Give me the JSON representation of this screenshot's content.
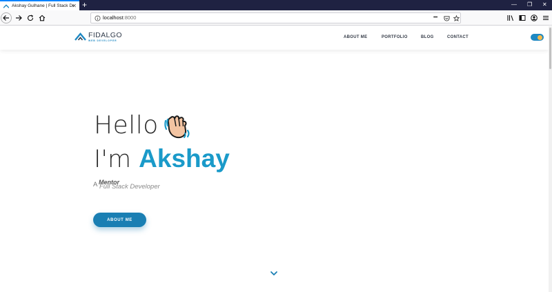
{
  "browser": {
    "tab_title": "Akshay Gulhane | Full Stack Developer",
    "url_host": "localhost",
    "url_port": ":8000",
    "url_actions_more": "•••"
  },
  "site": {
    "logo_word": "FIDALGO",
    "logo_tagline": "WEB DEVELOPER",
    "nav": [
      "ABOUT ME",
      "PORTFOLIO",
      "BLOG",
      "CONTACT"
    ]
  },
  "hero": {
    "greeting": "Hello",
    "intro_prefix": "I'm ",
    "name": "Akshay",
    "typed_article": "A",
    "typed_word_1": "Mentor",
    "typed_word_2": "Full Stack Developer",
    "cta_label": "ABOUT ME"
  },
  "colors": {
    "accent": "#1a9ac9",
    "button": "#1a7fb3",
    "tabstrip": "#1f2242"
  }
}
